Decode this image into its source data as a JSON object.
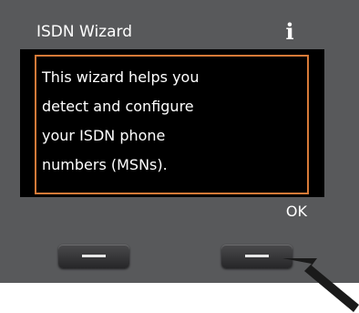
{
  "header": {
    "title": "ISDN Wizard",
    "info_icon": "info-icon"
  },
  "message": {
    "lines": [
      "This wizard helps you",
      "detect and configure",
      "your ISDN phone",
      "numbers (MSNs)."
    ]
  },
  "softkeys": {
    "left_label": "",
    "right_label": "OK"
  },
  "colors": {
    "device_body": "#58595b",
    "screen_background": "#000000",
    "message_border": "#d77a38",
    "text": "#ffffff",
    "pointer_arrow": "#1a1a1a"
  },
  "icons": {
    "left_key": "dash-icon",
    "right_key": "dash-icon",
    "pointer": "arrow-pointer-icon"
  }
}
